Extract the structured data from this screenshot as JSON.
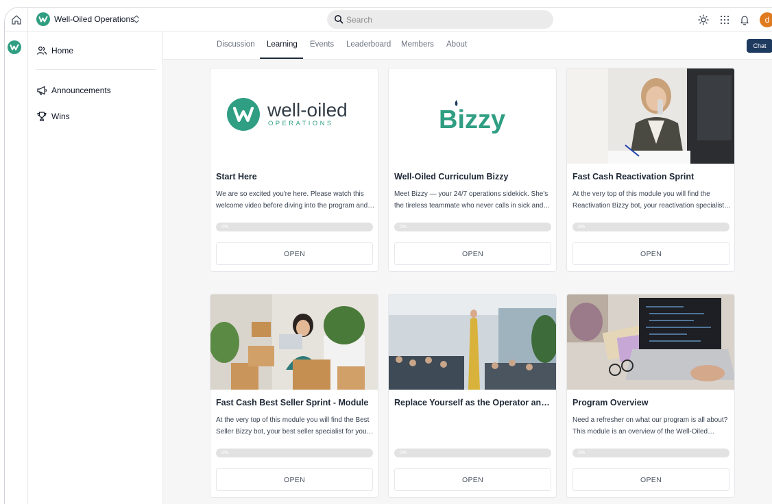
{
  "topbar": {
    "workspace_name": "Well-Oiled Operations",
    "search_placeholder": "Search",
    "avatar_initial": "d"
  },
  "sidebar": {
    "items": [
      {
        "label": "Home",
        "icon": "community-icon"
      },
      {
        "label": "Announcements",
        "icon": "megaphone-icon"
      },
      {
        "label": "Wins",
        "icon": "trophy-icon"
      }
    ]
  },
  "tabs": [
    {
      "label": "Discussion",
      "active": false
    },
    {
      "label": "Learning",
      "active": true
    },
    {
      "label": "Events",
      "active": false
    },
    {
      "label": "Leaderboard",
      "active": false
    },
    {
      "label": "Members",
      "active": false
    },
    {
      "label": "About",
      "active": false
    }
  ],
  "chat_label": "Chat",
  "logos": {
    "wellOiled_word": "well-oiled",
    "wellOiled_sub": "OPERATIONS",
    "bizzy": "Bizzy"
  },
  "colors": {
    "brand": "#2f9e82",
    "chat": "#1e3a5f",
    "avatar": "#e07a1f"
  },
  "courses": [
    {
      "title": "Start Here",
      "description": "We are so excited you're here. Please watch this welcome video before diving into the program and then proceed through each module in order.",
      "progress": 0,
      "progress_label": "0%",
      "button": "OPEN",
      "thumb": "well-oiled-logo"
    },
    {
      "title": "Well-Oiled Curriculum Bizzy",
      "description": "Meet Bizzy — your 24/7 operations sidekick. She's the tireless teammate who never calls in sick and always has an answer ready.",
      "progress": 0,
      "progress_label": "0%",
      "button": "OPEN",
      "thumb": "bizzy-logo"
    },
    {
      "title": "Fast Cash Reactivation Sprint",
      "description": "At the very top of this module you will find the Reactivation Bizzy bot, your reactivation specialist for past clients.",
      "progress": 0,
      "progress_label": "0%",
      "button": "OPEN",
      "thumb": "woman-on-phone-photo"
    },
    {
      "title": "Fast Cash Best Seller Sprint - Module",
      "description": "At the very top of this module you will find the Best Seller Bizzy bot, your best seller specialist for your offers.",
      "progress": 0,
      "progress_label": "0%",
      "button": "OPEN",
      "thumb": "packing-boxes-photo"
    },
    {
      "title": "Replace Yourself as the Operator and Scale",
      "description": "",
      "progress": 0,
      "progress_label": "0%",
      "button": "OPEN",
      "thumb": "speaker-on-stage-photo"
    },
    {
      "title": "Program Overview",
      "description": "Need a refresher on what our program is all about? This module is an overview of the Well-Oiled Operations program.",
      "progress": 0,
      "progress_label": "0%",
      "button": "OPEN",
      "thumb": "laptop-desk-photo"
    }
  ]
}
